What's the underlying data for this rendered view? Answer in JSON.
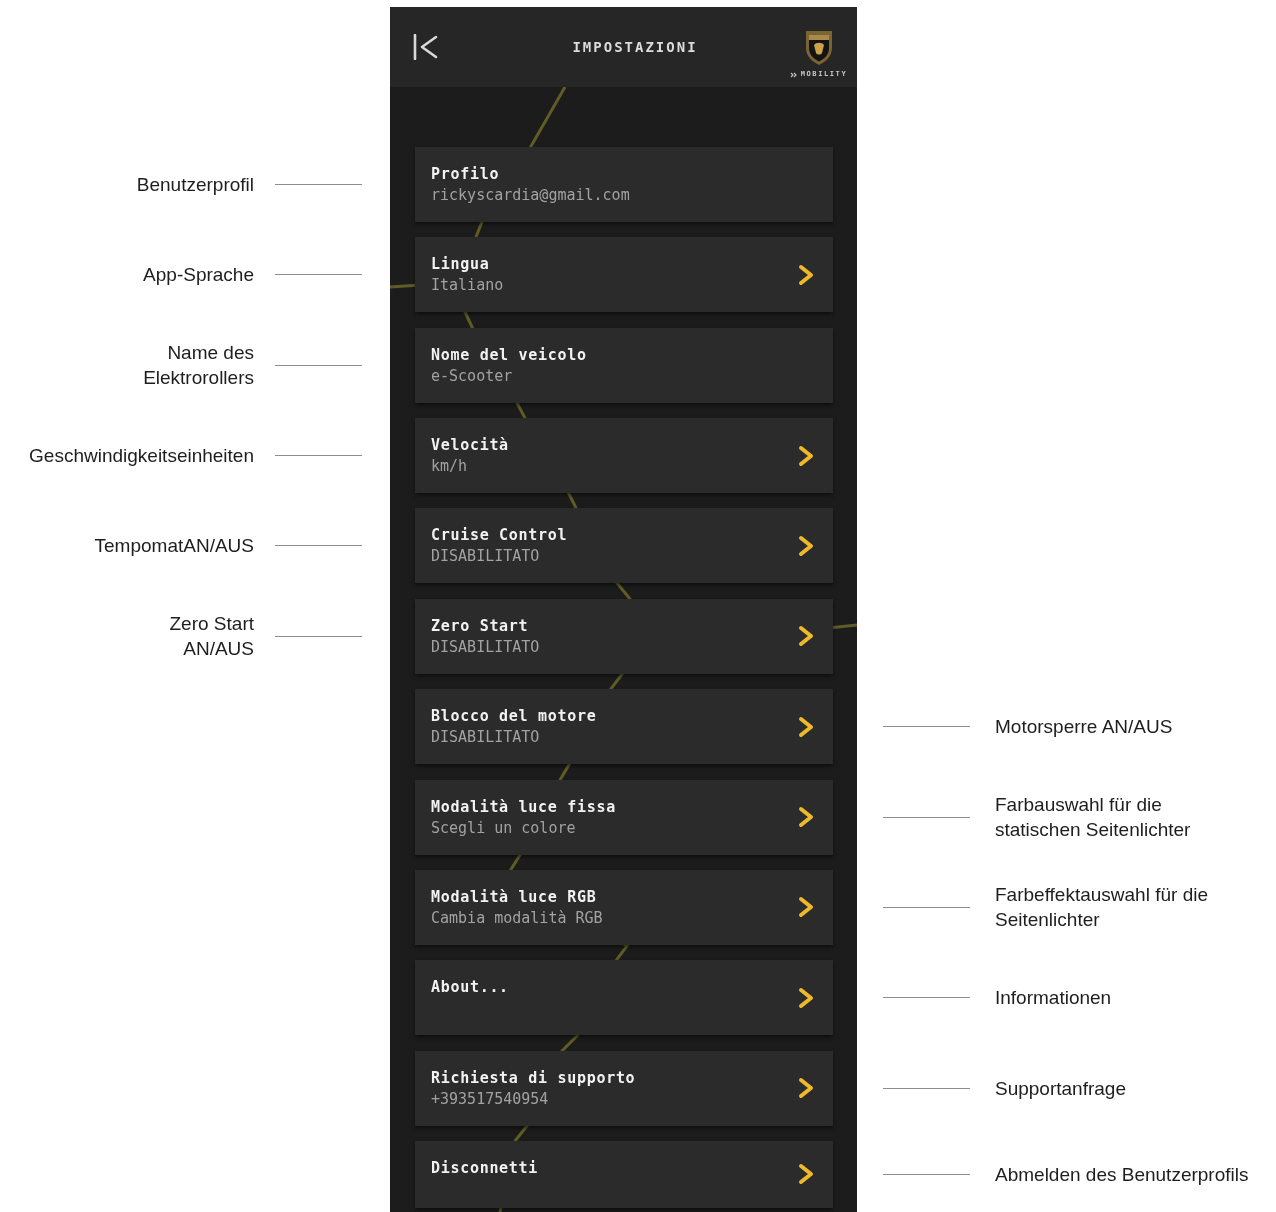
{
  "header": {
    "title": "IMPOSTAZIONI",
    "logo_caption": "MOBILITY"
  },
  "settings": [
    {
      "title": "Profilo",
      "subtitle": "rickyscardia@gmail.com",
      "chevron": false,
      "note_left": [
        "Benutzerprofil"
      ]
    },
    {
      "title": "Lingua",
      "subtitle": "Italiano",
      "chevron": true,
      "note_left": [
        "App-Sprache"
      ]
    },
    {
      "title": "Nome del veicolo",
      "subtitle": "e-Scooter",
      "chevron": false,
      "note_left": [
        "Name des",
        "Elektrorollers"
      ]
    },
    {
      "title": "Velocità",
      "subtitle": "km/h",
      "chevron": true,
      "note_left": [
        "Geschwindigkeitseinheiten"
      ]
    },
    {
      "title": "Cruise Control",
      "subtitle": "DISABILITATO",
      "chevron": true,
      "note_left": [
        "TempomatAN/AUS"
      ]
    },
    {
      "title": "Zero Start",
      "subtitle": "DISABILITATO",
      "chevron": true,
      "note_left": [
        "Zero Start",
        "AN/AUS"
      ]
    },
    {
      "title": "Blocco del motore",
      "subtitle": "DISABILITATO",
      "chevron": true,
      "note_right": [
        "Motorsperre AN/AUS"
      ]
    },
    {
      "title": "Modalità luce fissa",
      "subtitle": "Scegli un colore",
      "chevron": true,
      "note_right": [
        "Farbauswahl für die",
        "statischen Seitenlichter"
      ]
    },
    {
      "title": "Modalità luce RGB",
      "subtitle": "Cambia modalità RGB",
      "chevron": true,
      "note_right": [
        "Farbeffektauswahl für die",
        "Seitenlichter"
      ]
    },
    {
      "title": "About...",
      "chevron": true,
      "note_right": [
        "Informationen"
      ]
    },
    {
      "title": "Richiesta di supporto",
      "subtitle": "+393517540954",
      "chevron": true,
      "note_right": [
        "Supportanfrage"
      ]
    },
    {
      "title": "Disconnetti",
      "chevron": true,
      "note_right": [
        "Abmelden des Benutzerprofils"
      ]
    }
  ]
}
